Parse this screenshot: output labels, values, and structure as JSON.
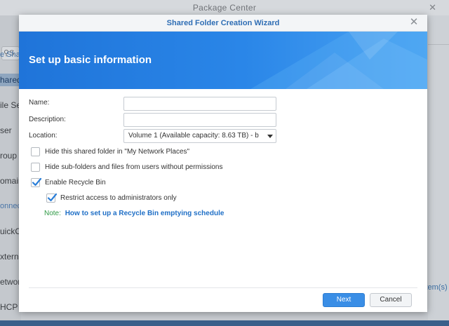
{
  "background_app": {
    "title": "Package Center",
    "search_placeholder": "S",
    "sidebar_items": [
      {
        "label": "e Shar",
        "kind": "section"
      },
      {
        "label": "hared",
        "kind": "active"
      },
      {
        "label": "ile Se",
        "kind": "item"
      },
      {
        "label": "ser",
        "kind": "item"
      },
      {
        "label": "roup",
        "kind": "item"
      },
      {
        "label": "omain",
        "kind": "item"
      },
      {
        "label": "onnect",
        "kind": "section"
      },
      {
        "label": "uickC",
        "kind": "item"
      },
      {
        "label": "xtern",
        "kind": "item"
      },
      {
        "label": "etwor",
        "kind": "item"
      },
      {
        "label": "HCP S",
        "kind": "item"
      }
    ],
    "items_count_text": "item(s)"
  },
  "dialog": {
    "title": "Shared Folder Creation Wizard",
    "close_icon": "close-icon",
    "banner_title": "Set up basic information",
    "form": {
      "name_label": "Name:",
      "name_value": "",
      "description_label": "Description:",
      "description_value": "",
      "location_label": "Location:",
      "location_value": "Volume 1 (Available capacity:  8.63 TB) - b"
    },
    "options": [
      {
        "label": "Hide this shared folder in \"My Network Places\"",
        "checked": false
      },
      {
        "label": "Hide sub-folders and files from users without permissions",
        "checked": false
      },
      {
        "label": "Enable Recycle Bin",
        "checked": true
      },
      {
        "label": "Restrict access to administrators only",
        "checked": true
      }
    ],
    "note": {
      "label": "Note:",
      "link_text": "How to set up a Recycle Bin emptying schedule"
    },
    "buttons": {
      "next": "Next",
      "cancel": "Cancel"
    }
  },
  "colors": {
    "accent": "#2e6db4",
    "banner_start": "#1f74d9",
    "banner_end": "#4aa3f2",
    "primary_button": "#3a8ee6",
    "note_green": "#2f9a45"
  }
}
